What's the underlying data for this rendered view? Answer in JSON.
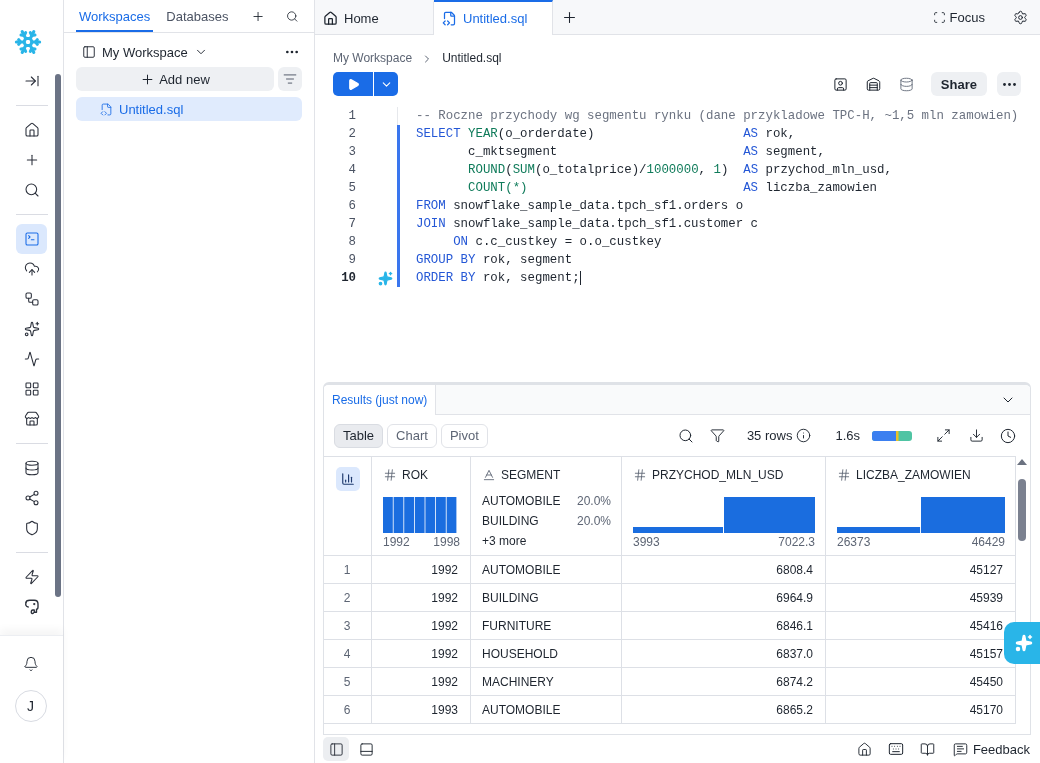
{
  "rail": {
    "groups": [
      [
        {
          "selected": false
        }
      ],
      [
        {
          "selected": false
        },
        {
          "selected": false
        },
        {
          "selected": false
        }
      ],
      [
        {
          "selected": true
        },
        {
          "selected": false
        },
        {
          "selected": false
        },
        {
          "selected": false
        },
        {
          "selected": false
        },
        {
          "selected": false
        },
        {
          "selected": false
        }
      ],
      [
        {
          "selected": false
        },
        {
          "selected": false
        },
        {
          "selected": false
        }
      ],
      [
        {
          "selected": false
        },
        {
          "selected": false
        }
      ]
    ],
    "avatar": "J"
  },
  "sidebar": {
    "tabs": [
      {
        "label": "Workspaces",
        "selected": true
      },
      {
        "label": "Databases",
        "selected": false
      }
    ],
    "workspace": "My Workspace",
    "add_button": "Add new",
    "files": [
      {
        "name": "Untitled.sql",
        "selected": true
      }
    ]
  },
  "tabs": [
    {
      "label": "Home",
      "kind": "home",
      "selected": false
    },
    {
      "label": "Untitled.sql",
      "kind": "sql",
      "selected": true
    }
  ],
  "focus": "Focus",
  "breadcrumb": [
    "My Workspace",
    "Untitled.sql"
  ],
  "share": "Share",
  "editor": {
    "lines": [
      {
        "number": "1",
        "active": false,
        "modified": false,
        "tokens": [
          {
            "kind": "comment",
            "t": "-- Roczne przychody wg segmentu rynku (dane przykladowe TPC-H, ~1,5 mln zamowien)"
          }
        ]
      },
      {
        "number": "2",
        "active": false,
        "modified": true,
        "tokens": [
          {
            "kind": "kw",
            "t": "SELECT "
          },
          {
            "kind": "fn",
            "t": "YEAR"
          },
          {
            "kind": "plain",
            "t": "(o_orderdate)                    "
          },
          {
            "kind": "kw",
            "t": "AS"
          },
          {
            "kind": "plain",
            "t": " rok,"
          }
        ]
      },
      {
        "number": "3",
        "active": false,
        "modified": true,
        "tokens": [
          {
            "kind": "plain",
            "t": "       c_mktsegment                         "
          },
          {
            "kind": "kw",
            "t": "AS"
          },
          {
            "kind": "plain",
            "t": " segment,"
          }
        ]
      },
      {
        "number": "4",
        "active": false,
        "modified": true,
        "tokens": [
          {
            "kind": "fn",
            "t": "       ROUND"
          },
          {
            "kind": "plain",
            "t": "("
          },
          {
            "kind": "fn",
            "t": "SUM"
          },
          {
            "kind": "plain",
            "t": "(o_totalprice)/"
          },
          {
            "kind": "num",
            "t": "1000000"
          },
          {
            "kind": "plain",
            "t": ", "
          },
          {
            "kind": "num",
            "t": "1"
          },
          {
            "kind": "plain",
            "t": ")  "
          },
          {
            "kind": "kw",
            "t": "AS"
          },
          {
            "kind": "plain",
            "t": " przychod_mln_usd,"
          }
        ]
      },
      {
        "number": "5",
        "active": false,
        "modified": true,
        "tokens": [
          {
            "kind": "fn",
            "t": "       COUNT(*)"
          },
          {
            "kind": "kw",
            "t": "                             AS"
          },
          {
            "kind": "plain",
            "t": " liczba_zamowien"
          }
        ]
      },
      {
        "number": "6",
        "active": false,
        "modified": true,
        "tokens": [
          {
            "kind": "kw",
            "t": "FROM"
          },
          {
            "kind": "plain",
            "t": " snowflake_sample_data.tpch_sf1.orders o"
          }
        ]
      },
      {
        "number": "7",
        "active": false,
        "modified": true,
        "tokens": [
          {
            "kind": "kw",
            "t": "JOIN"
          },
          {
            "kind": "plain",
            "t": " snowflake_sample_data.tpch_sf1.customer c"
          }
        ]
      },
      {
        "number": "8",
        "active": false,
        "modified": true,
        "tokens": [
          {
            "kind": "kw",
            "t": "     ON"
          },
          {
            "kind": "plain",
            "t": " c.c_custkey = o.o_custkey"
          }
        ]
      },
      {
        "number": "9",
        "active": false,
        "modified": true,
        "tokens": [
          {
            "kind": "kw",
            "t": "GROUP BY"
          },
          {
            "kind": "plain",
            "t": " rok, segment"
          }
        ]
      },
      {
        "number": "10",
        "active": true,
        "modified": true,
        "tokens": [
          {
            "kind": "kw",
            "t": "ORDER BY"
          },
          {
            "kind": "plain",
            "t": " rok, segment;"
          }
        ]
      }
    ]
  },
  "results": {
    "tab": "Results (just now)",
    "views": [
      {
        "label": "Table",
        "selected": true
      },
      {
        "label": "Chart",
        "selected": false
      },
      {
        "label": "Pivot",
        "selected": false
      }
    ],
    "row_count": "35 rows",
    "duration": "1.6s",
    "columns": [
      {
        "name": "ROK",
        "kind": "number",
        "histogram": {
          "kind": "uniform"
        },
        "min": "1992",
        "max": "1998"
      },
      {
        "name": "SEGMENT",
        "kind": "text",
        "top": [
          {
            "value": "AUTOMOBILE",
            "share": "20.0%"
          },
          {
            "value": "BUILDING",
            "share": "20.0%"
          }
        ],
        "more": "+3 more"
      },
      {
        "name": "PRZYCHOD_MLN_USD",
        "kind": "number",
        "histogram": {
          "kind": "skewed"
        },
        "min": "3993",
        "max": "7022.3"
      },
      {
        "name": "LICZBA_ZAMOWIEN",
        "kind": "number",
        "histogram": {
          "kind": "skewed"
        },
        "min": "26373",
        "max": "46429"
      }
    ],
    "rows": [
      {
        "index": "1",
        "cells": [
          "1992",
          "AUTOMOBILE",
          "6808.4",
          "45127"
        ]
      },
      {
        "index": "2",
        "cells": [
          "1992",
          "BUILDING",
          "6964.9",
          "45939"
        ]
      },
      {
        "index": "3",
        "cells": [
          "1992",
          "FURNITURE",
          "6846.1",
          "45416"
        ]
      },
      {
        "index": "4",
        "cells": [
          "1992",
          "HOUSEHOLD",
          "6837.0",
          "45157"
        ]
      },
      {
        "index": "5",
        "cells": [
          "1992",
          "MACHINERY",
          "6874.2",
          "45450"
        ]
      },
      {
        "index": "6",
        "cells": [
          "1993",
          "AUTOMOBILE",
          "6865.2",
          "45170"
        ]
      }
    ]
  },
  "status_bar": {
    "feedback": "Feedback"
  }
}
